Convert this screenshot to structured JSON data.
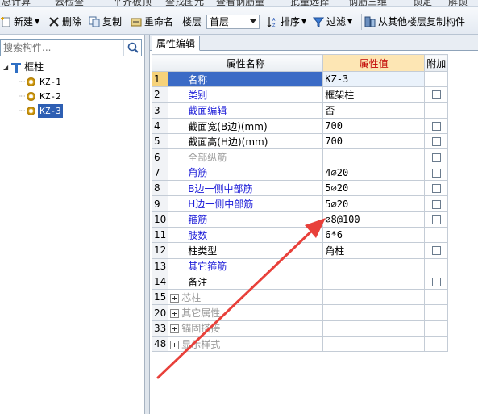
{
  "top_strip": [
    "总计算",
    "云检查",
    "平齐板顶",
    "查找图元",
    "查看钢筋量",
    "批量选择",
    "钢筋三维",
    "锁定",
    "解锁"
  ],
  "toolbar": {
    "new_label": "新建",
    "delete_label": "删除",
    "copy_label": "复制",
    "rename_label": "重命名",
    "floor_label": "楼层",
    "floor_value": "首层",
    "sort_label": "排序",
    "filter_label": "过滤",
    "copy_from_floor_label": "从其他楼层复制构件"
  },
  "search": {
    "placeholder": "搜索构件..."
  },
  "tree": {
    "root": "框柱",
    "items": [
      "KZ-1",
      "KZ-2",
      "KZ-3"
    ],
    "selected": "KZ-3"
  },
  "tab": {
    "label": "属性编辑"
  },
  "grid": {
    "headers": {
      "name": "属性名称",
      "value": "属性值",
      "extra": "附加"
    },
    "rows": [
      {
        "num": "1",
        "name": "名称",
        "value": "KZ-3"
      },
      {
        "num": "2",
        "name": "类别",
        "value": "框架柱"
      },
      {
        "num": "3",
        "name": "截面编辑",
        "value": "否"
      },
      {
        "num": "4",
        "name": "截面宽(B边)(mm)",
        "value": "700"
      },
      {
        "num": "5",
        "name": "截面高(H边)(mm)",
        "value": "700"
      },
      {
        "num": "6",
        "name": "全部纵筋",
        "value": ""
      },
      {
        "num": "7",
        "name": "角筋",
        "value": "4⌀20"
      },
      {
        "num": "8",
        "name": "B边一侧中部筋",
        "value": "5⌀20"
      },
      {
        "num": "9",
        "name": "H边一侧中部筋",
        "value": "5⌀20"
      },
      {
        "num": "10",
        "name": "箍筋",
        "value": "⌀8@100"
      },
      {
        "num": "11",
        "name": "肢数",
        "value": "6*6"
      },
      {
        "num": "12",
        "name": "柱类型",
        "value": "角柱"
      },
      {
        "num": "13",
        "name": "其它箍筋",
        "value": ""
      },
      {
        "num": "14",
        "name": "备注",
        "value": ""
      },
      {
        "num": "15",
        "name": "芯柱",
        "value": ""
      },
      {
        "num": "20",
        "name": "其它属性",
        "value": ""
      },
      {
        "num": "33",
        "name": "锚固搭接",
        "value": ""
      },
      {
        "num": "48",
        "name": "显示样式",
        "value": ""
      }
    ]
  },
  "colors": {
    "annotation_arrow": "#e8403a",
    "selection": "#3b6bc6",
    "value_header": "#fde6b4"
  }
}
